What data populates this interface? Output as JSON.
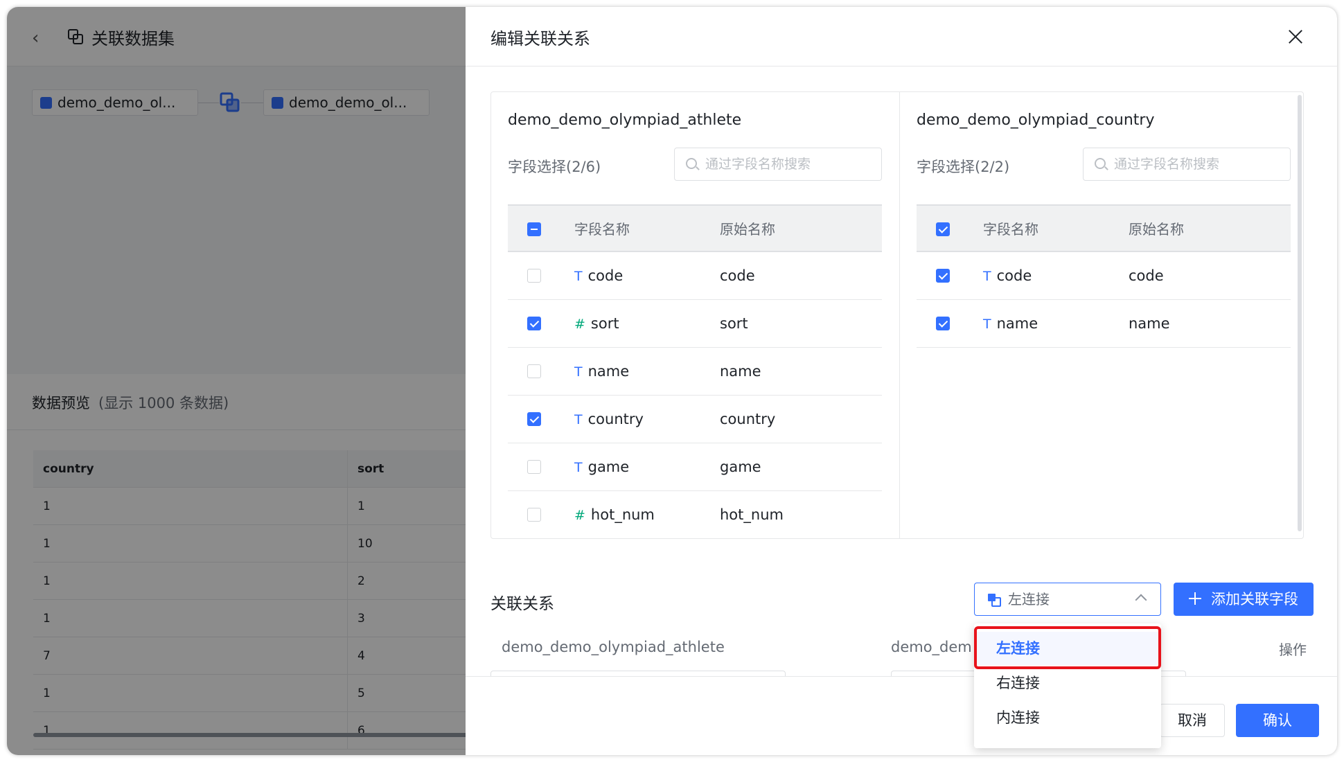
{
  "background": {
    "title": "关联数据集",
    "node_left": "demo_demo_ol...",
    "node_right": "demo_demo_ol...",
    "preview_title": "数据预览",
    "preview_sub": "(显示 1000 条数据)",
    "table": {
      "headers": [
        "country",
        "sort"
      ],
      "rows": [
        [
          "1",
          "1"
        ],
        [
          "1",
          "10"
        ],
        [
          "1",
          "2"
        ],
        [
          "1",
          "3"
        ],
        [
          "7",
          "4"
        ],
        [
          "1",
          "5"
        ],
        [
          "1",
          "6"
        ]
      ]
    }
  },
  "drawer": {
    "title": "编辑关联关系",
    "left": {
      "title": "demo_demo_olympiad_athlete",
      "selection": "字段选择(2/6)",
      "search_placeholder": "通过字段名称搜索",
      "head_name": "字段名称",
      "head_orig": "原始名称",
      "rows": [
        {
          "type": "T",
          "name": "code",
          "orig": "code"
        },
        {
          "type": "#",
          "name": "sort",
          "orig": "sort"
        },
        {
          "type": "T",
          "name": "name",
          "orig": "name"
        },
        {
          "type": "T",
          "name": "country",
          "orig": "country"
        },
        {
          "type": "T",
          "name": "game",
          "orig": "game"
        },
        {
          "type": "#",
          "name": "hot_num",
          "orig": "hot_num"
        }
      ]
    },
    "right": {
      "title": "demo_demo_olympiad_country",
      "selection": "字段选择(2/2)",
      "search_placeholder": "通过字段名称搜索",
      "head_name": "字段名称",
      "head_orig": "原始名称",
      "rows": [
        {
          "type": "T",
          "name": "code",
          "orig": "code"
        },
        {
          "type": "T",
          "name": "name",
          "orig": "name"
        }
      ]
    },
    "relation_title": "关联关系",
    "join_type": "左连接",
    "add_button": "添加关联字段",
    "col_left": "demo_demo_olympiad_athlete",
    "col_right": "demo_dem",
    "col_op": "操作",
    "cancel": "取消",
    "confirm": "确认",
    "dropdown": [
      "左连接",
      "右连接",
      "内连接"
    ]
  },
  "colors": {
    "accent": "#3370ff",
    "highlight": "#e8131b"
  }
}
